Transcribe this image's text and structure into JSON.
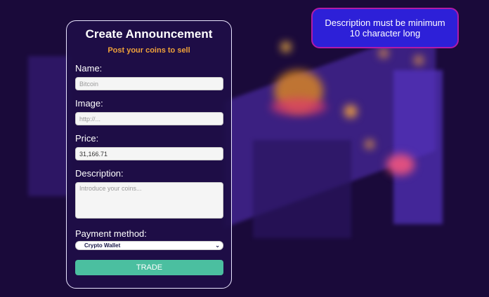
{
  "form": {
    "title": "Create Announcement",
    "subtitle": "Post your coins to sell",
    "name_label": "Name:",
    "name_placeholder": "Bitcoin",
    "image_label": "Image:",
    "image_placeholder": "http://...",
    "price_label": "Price:",
    "price_value": "31,166.71",
    "description_label": "Description:",
    "description_placeholder": "Introduce your coins...",
    "payment_label": "Payment method:",
    "payment_selected": "Crypto Wallet",
    "submit_label": "TRADE"
  },
  "toast": {
    "message": "Description must be minimum 10 character long"
  },
  "colors": {
    "background": "#1a0a3a",
    "accent_orange": "#f0a23a",
    "button_teal": "#4bbfa0",
    "toast_blue": "#2d20d8"
  }
}
